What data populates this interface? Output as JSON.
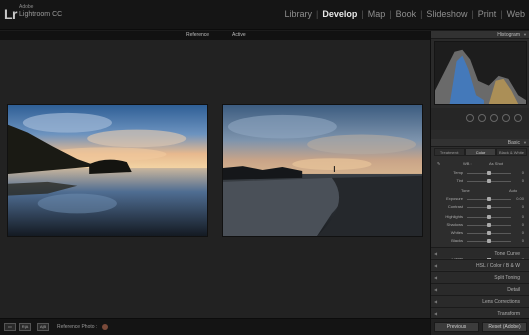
{
  "app": {
    "logo": "Lr",
    "vendor": "Adobe",
    "product": "Lightroom CC"
  },
  "modules": [
    "Library",
    "Develop",
    "Map",
    "Book",
    "Slideshow",
    "Print",
    "Web"
  ],
  "active_module": "Develop",
  "view_header": {
    "reference_label": "Reference",
    "active_label": "Active"
  },
  "right_panel": {
    "histogram_title": "Histogram",
    "basic_title": "Basic",
    "treatment_tabs": [
      "Treatment:",
      "Color",
      "Black & White"
    ],
    "wb_label": "WB :",
    "wb_value": "As Shot",
    "tone_label": "Tone",
    "tone_value": "Auto",
    "presence_label": "Presence",
    "sliders": [
      {
        "name": "Temp",
        "value": "0"
      },
      {
        "name": "Tint",
        "value": "0"
      },
      {
        "name": "Exposure",
        "value": "0.00"
      },
      {
        "name": "Contrast",
        "value": "0"
      },
      {
        "name": "Highlights",
        "value": "0"
      },
      {
        "name": "Shadows",
        "value": "0"
      },
      {
        "name": "Whites",
        "value": "0"
      },
      {
        "name": "Blacks",
        "value": "0"
      },
      {
        "name": "Clarity",
        "value": "0"
      },
      {
        "name": "Vibrance",
        "value": "0"
      },
      {
        "name": "Saturation",
        "value": "0"
      }
    ],
    "collapsed_panels": [
      "Tone Curve",
      "HSL / Color / B & W",
      "Split Toning",
      "Detail",
      "Lens Corrections",
      "Transform"
    ],
    "previous_button": "Previous",
    "reset_button": "Reset (Adobe)"
  },
  "bottom_bar": {
    "view_buttons": [
      "R|A",
      "A|B"
    ],
    "reference_photo_label": "Reference Photo :"
  }
}
